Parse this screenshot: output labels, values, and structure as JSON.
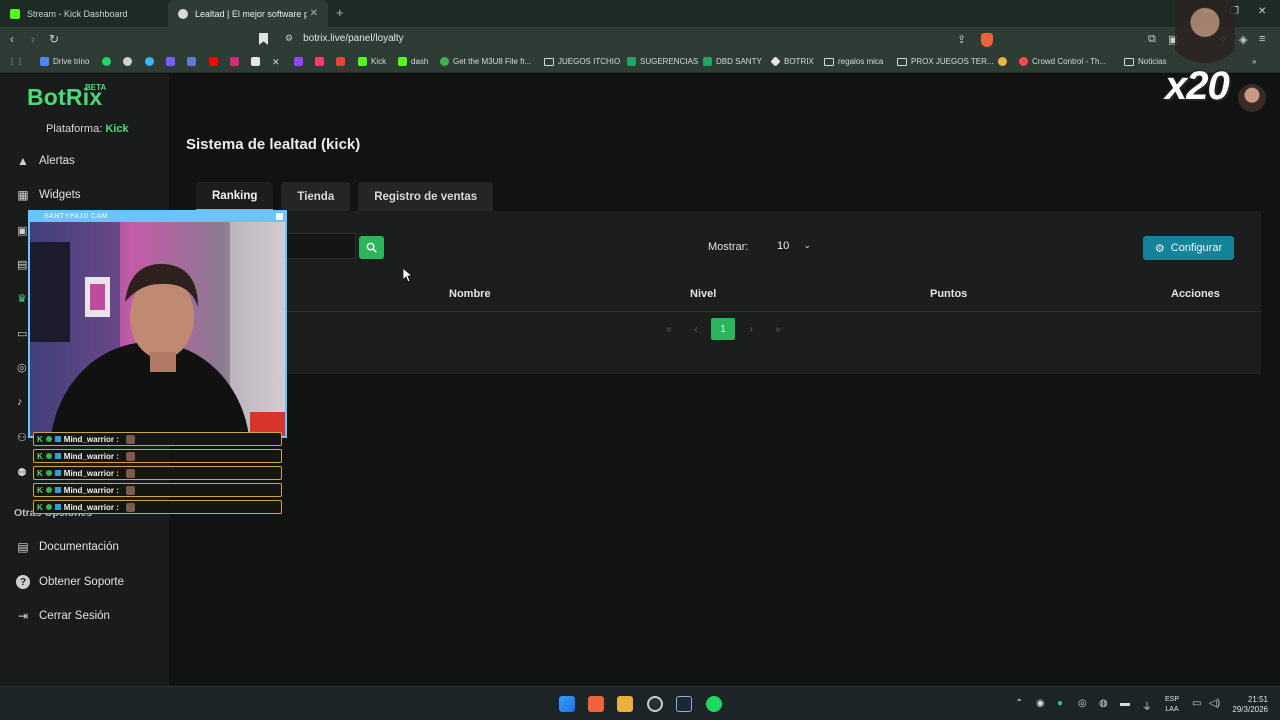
{
  "browser": {
    "tabs": [
      {
        "title": "Stream - Kick Dashboard",
        "favicon_color": "#53fc18"
      },
      {
        "title": "Lealtad | El mejor software para...",
        "favicon_color": "#d9d9d9"
      }
    ],
    "url": "botrix.live/panel/loyalty",
    "bookmarks": [
      {
        "label": "Drive trino",
        "icon": "drive-icon",
        "color": "#4f86f7"
      },
      {
        "label": "Kick",
        "icon": "kick-icon",
        "color": "#53fc18"
      },
      {
        "label": "dash",
        "icon": "kick-icon",
        "color": "#53fc18"
      },
      {
        "label": "Get the M3U8 File fr...",
        "icon": "check-icon",
        "color": "#3fb34f"
      },
      {
        "label": "JUEGOS ITCHIO",
        "icon": "folder-icon",
        "color": "#cfd7d2"
      },
      {
        "label": "SUGERENCIAS",
        "icon": "sheet-icon",
        "color": "#21a464"
      },
      {
        "label": "DBD SANTY",
        "icon": "sheet-icon",
        "color": "#21a464"
      },
      {
        "label": "BOTRIX",
        "icon": "botrix-icon",
        "color": "#e6e6e6"
      },
      {
        "label": "regalos mica",
        "icon": "folder-icon",
        "color": "#cfd7d2"
      },
      {
        "label": "PROX JUEGOS TER...",
        "icon": "folder-icon",
        "color": "#cfd7d2"
      },
      {
        "label": "Crowd Control - Th...",
        "icon": "crowd-icon",
        "color": "#ff4a4a"
      },
      {
        "label": "Noticias",
        "icon": "folder-icon",
        "color": "#cfd7d2"
      }
    ]
  },
  "app": {
    "logo": "BotRix",
    "logo_badge": "BETA",
    "platform_label": "Plataforma:",
    "platform_value": "Kick",
    "sidebar": {
      "items": [
        {
          "label": "Alertas",
          "icon": "alert-icon"
        },
        {
          "label": "Widgets",
          "icon": "widgets-icon"
        }
      ],
      "section": "Otras Opciones",
      "bottom_items": [
        {
          "label": "Documentación",
          "icon": "document-icon"
        },
        {
          "label": "Obtener Soporte",
          "icon": "help-icon"
        },
        {
          "label": "Cerrar Sesión",
          "icon": "logout-icon"
        }
      ]
    },
    "page_title": "Sistema de lealtad (kick)",
    "tabs": [
      {
        "label": "Ranking",
        "active": true
      },
      {
        "label": "Tienda",
        "active": false
      },
      {
        "label": "Registro de ventas",
        "active": false
      }
    ],
    "toolbar": {
      "show_label": "Mostrar:",
      "show_value": "10",
      "configure_label": "Configurar"
    },
    "table": {
      "headers": [
        "Nombre",
        "Nivel",
        "Puntos",
        "Acciones"
      ],
      "rows": []
    },
    "pagination": {
      "first": "«",
      "prev": "‹",
      "current": "1",
      "next": "›",
      "last": "»"
    },
    "colors": {
      "accent": "#4ed87a",
      "primary_button": "#2db55d",
      "configure_button": "#14849b"
    }
  },
  "overlay": {
    "cam_title": "SANTYPA10 CAM",
    "chat_messages": [
      {
        "user": "Mind_warrior :"
      },
      {
        "user": "Mind_warrior :"
      },
      {
        "user": "Mind_warrior :"
      },
      {
        "user": "Mind_warrior :"
      },
      {
        "user": "Mind_warrior :"
      }
    ],
    "multiplier": "x20"
  },
  "taskbar": {
    "lang": "ESP",
    "region": "LAA",
    "time": "21:51",
    "date": "29/3/2026"
  }
}
